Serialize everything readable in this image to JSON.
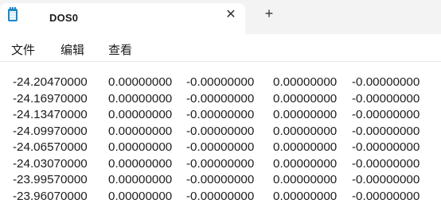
{
  "tab": {
    "title": "DOS0",
    "close_glyph": "✕",
    "new_tab_glyph": "+"
  },
  "menu": {
    "file": "文件",
    "edit": "编辑",
    "view": "查看"
  },
  "rows": [
    [
      "-24.20470000",
      "0.00000000",
      "-0.00000000",
      "0.00000000",
      "-0.00000000"
    ],
    [
      "-24.16970000",
      "0.00000000",
      "-0.00000000",
      "0.00000000",
      "-0.00000000"
    ],
    [
      "-24.13470000",
      "0.00000000",
      "-0.00000000",
      "0.00000000",
      "-0.00000000"
    ],
    [
      "-24.09970000",
      "0.00000000",
      "-0.00000000",
      "0.00000000",
      "-0.00000000"
    ],
    [
      "-24.06570000",
      "0.00000000",
      "-0.00000000",
      "0.00000000",
      "-0.00000000"
    ],
    [
      "-24.03070000",
      "0.00000000",
      "-0.00000000",
      "0.00000000",
      "-0.00000000"
    ],
    [
      "-23.99570000",
      "0.00000000",
      "-0.00000000",
      "0.00000000",
      "-0.00000000"
    ],
    [
      "-23.96070000",
      "0.00000000",
      "-0.00000000",
      "0.00000000",
      "-0.00000000"
    ]
  ]
}
